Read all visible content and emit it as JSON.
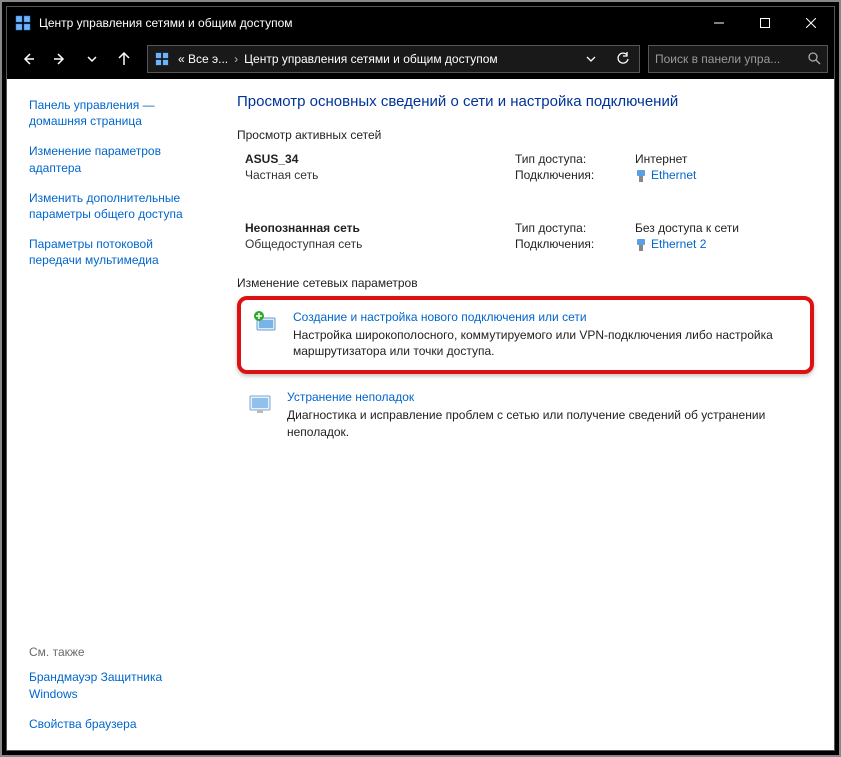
{
  "titlebar": {
    "title": "Центр управления сетями и общим доступом"
  },
  "address": {
    "seg1": "« Все э...",
    "seg2": "Центр управления сетями и общим доступом"
  },
  "search": {
    "placeholder": "Поиск в панели упра..."
  },
  "sidebar": {
    "links": [
      "Панель управления — домашняя страница",
      "Изменение параметров адаптера",
      "Изменить дополнительные параметры общего доступа",
      "Параметры потоковой передачи мультимедиа"
    ],
    "see_also_label": "См. также",
    "see_also_links": [
      "Брандмауэр Защитника Windows",
      "Свойства браузера"
    ]
  },
  "main": {
    "page_title": "Просмотр основных сведений о сети и настройка подключений",
    "active_networks_label": "Просмотр активных сетей",
    "networks": [
      {
        "name": "ASUS_34",
        "type": "Частная сеть",
        "access_label": "Тип доступа:",
        "access_value": "Интернет",
        "conn_label": "Подключения:",
        "conn_value": "Ethernet",
        "has_icon": true
      },
      {
        "name": "Неопознанная сеть",
        "type": "Общедоступная сеть",
        "access_label": "Тип доступа:",
        "access_value": "Без доступа к сети",
        "conn_label": "Подключения:",
        "conn_value": "Ethernet 2",
        "has_icon": true
      }
    ],
    "change_settings_label": "Изменение сетевых параметров",
    "tasks": [
      {
        "title": "Создание и настройка нового подключения или сети",
        "desc": "Настройка широкополосного, коммутируемого или VPN-подключения либо настройка маршрутизатора или точки доступа.",
        "highlighted": true
      },
      {
        "title": "Устранение неполадок",
        "desc": "Диагностика и исправление проблем с сетью или получение сведений об устранении неполадок.",
        "highlighted": false
      }
    ]
  }
}
